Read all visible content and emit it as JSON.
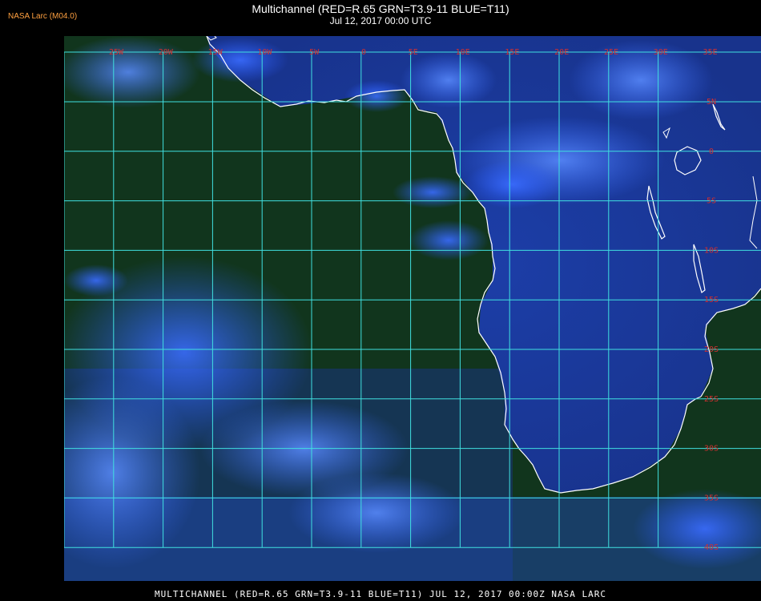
{
  "header": {
    "brand": "NASA Larc (M04.0)",
    "title": "Multichannel (RED=R.65 GRN=T3.9-11 BLUE=T11)",
    "subtitle": "Jul 12, 2017 00:00 UTC"
  },
  "map": {
    "lon_labels": [
      "25W",
      "20W",
      "15W",
      "10W",
      "5W",
      "0",
      "5E",
      "10E",
      "15E",
      "20E",
      "25E",
      "30E",
      "35E"
    ],
    "lat_labels": [
      "5N",
      "0",
      "5S",
      "10S",
      "15S",
      "20S",
      "25S",
      "30S",
      "35S",
      "40S"
    ],
    "grid_color": "#40e0e0",
    "coast_color": "#ffffff",
    "label_color": "#d03030",
    "ocean_color": "#143a1c",
    "cloud_color": "#2a5cff"
  },
  "footer": {
    "caption": "MULTICHANNEL (RED=R.65 GRN=T3.9-11 BLUE=T11) JUL 12, 2017 00:00Z   NASA LARC"
  }
}
